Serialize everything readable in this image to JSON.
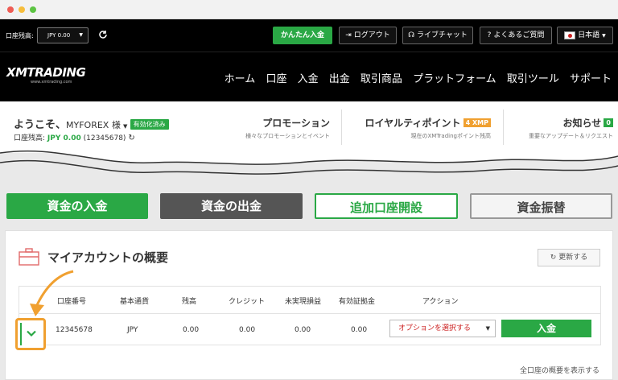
{
  "topbar": {
    "balance_label": "口座残高:",
    "balance_select": "JPY 0.00",
    "deposit_easy": "かんたん入金",
    "logout": "ログアウト",
    "live_chat": "ライブチャット",
    "faq": "よくあるご質問",
    "language": "日本語"
  },
  "nav": {
    "brand": "XMTRADING",
    "brand_sub": "www.xmtrading.com",
    "items": [
      "ホーム",
      "口座",
      "入金",
      "出金",
      "取引商品",
      "プラットフォーム",
      "取引ツール",
      "サポート"
    ]
  },
  "welcome": {
    "greeting": "ようこそ、",
    "user": "MYFOREX 様",
    "verified": "有効化済み",
    "balance_label": "口座残高:",
    "balance_value": "JPY 0.00",
    "account_id": "(12345678)",
    "promo_title": "プロモーション",
    "promo_sub": "様々なプロモーションとイベント",
    "loyalty_title": "ロイヤルティポイント",
    "loyalty_badge": "4 XMP",
    "loyalty_sub": "現在のXMTradingポイント残高",
    "news_title": "お知らせ",
    "news_count": "0",
    "news_sub": "重要なアップデート＆リクエスト"
  },
  "actions": {
    "deposit": "資金の入金",
    "withdraw": "資金の出金",
    "open_account": "追加口座開設",
    "transfer": "資金振替"
  },
  "summary": {
    "title": "マイアカウントの概要",
    "refresh": "更新する",
    "show_all": "全口座の概要を表示する",
    "columns": [
      "口座番号",
      "基本通貨",
      "残高",
      "クレジット",
      "未実現損益",
      "有効証拠金",
      "アクション"
    ],
    "row": {
      "account": "12345678",
      "currency": "JPY",
      "balance": "0.00",
      "credit": "0.00",
      "unrealized": "0.00",
      "equity": "0.00",
      "option": "オプションを選択する",
      "deposit": "入金"
    }
  },
  "colors": {
    "green": "#2aa845",
    "dark_gray": "#555555",
    "orange": "#f0a030",
    "red": "#cc2222",
    "black": "#000000"
  }
}
